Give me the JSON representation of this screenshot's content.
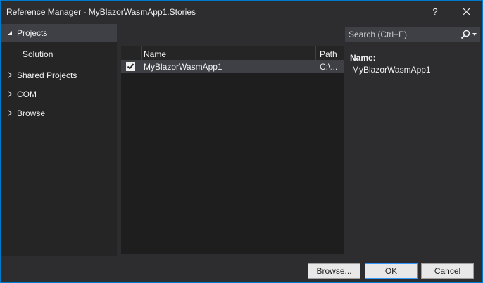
{
  "window": {
    "title": "Reference Manager - MyBlazorWasmApp1.Stories",
    "help_label": "?"
  },
  "sidebar": {
    "items": [
      {
        "label": "Projects",
        "icon": "triangle-expanded-icon",
        "selected": true
      },
      {
        "label": "Solution",
        "icon": "",
        "selected": false
      },
      {
        "label": "Shared Projects",
        "icon": "triangle-collapsed-icon",
        "selected": false
      },
      {
        "label": "COM",
        "icon": "triangle-collapsed-icon",
        "selected": false
      },
      {
        "label": "Browse",
        "icon": "triangle-collapsed-icon",
        "selected": false
      }
    ]
  },
  "search": {
    "placeholder": "Search (Ctrl+E)",
    "value": ""
  },
  "grid": {
    "columns": [
      "Name",
      "Path"
    ],
    "rows": [
      {
        "checked": true,
        "name": "MyBlazorWasmApp1",
        "path": "C:\\..."
      }
    ]
  },
  "details": {
    "label": "Name:",
    "value": "MyBlazorWasmApp1"
  },
  "buttons": {
    "browse": "Browse...",
    "ok": "OK",
    "cancel": "Cancel"
  },
  "colors": {
    "accent": "#007acc",
    "background": "#2d2d30",
    "panel": "#252526",
    "selection": "#3f3f46"
  }
}
